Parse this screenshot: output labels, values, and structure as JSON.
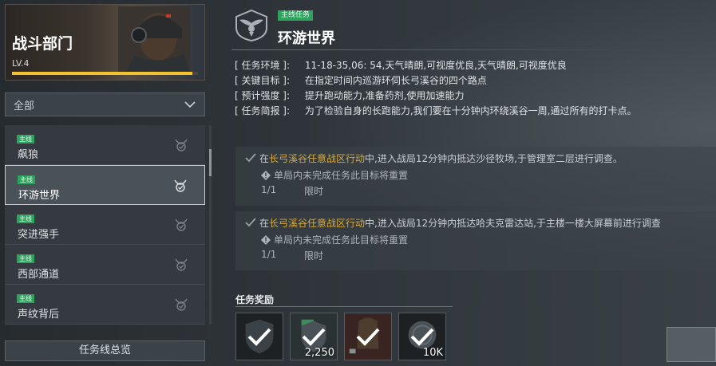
{
  "department": {
    "title": "战斗部门",
    "level": "LV.4",
    "progress": 0.97
  },
  "filter": {
    "selected": "全部",
    "icon": "chevron-down-icon"
  },
  "missions": [
    {
      "tag": "主线",
      "name": "飙狼",
      "state": "done"
    },
    {
      "tag": "主线",
      "name": "环游世界",
      "state": "done",
      "active": true
    },
    {
      "tag": "主线",
      "name": "突进强手",
      "state": "done"
    },
    {
      "tag": "主线",
      "name": "西部通道",
      "state": "done"
    },
    {
      "tag": "主线",
      "name": "声纹背后",
      "state": "done"
    }
  ],
  "overview_button": "任务线总览",
  "detail": {
    "tag": "主线任务",
    "title": "环游世界",
    "info": [
      {
        "label": "[ 任务环境 ]:",
        "value": "11-18-35,06: 54,天气晴朗,可视度优良,天气晴朗,可视度优良"
      },
      {
        "label": "[ 关键目标 ]:",
        "value": "在指定时间内巡游环伺长弓溪谷的四个路点"
      },
      {
        "label": "[ 预计强度 ]:",
        "value": "提升跑动能力,准备药剂,使用加速能力"
      },
      {
        "label": "[ 任务简报 ]:",
        "value": "为了检验自身的长跑能力,我们要在十分钟内环绕溪谷一周,通过所有的打卡点。"
      }
    ],
    "objectives": [
      {
        "prefix": "在",
        "highlight": "长弓溪谷任意战区行动",
        "suffix": "中,进入战局12分钟内抵达沙径牧场,于管理室二层进行调查。",
        "warning": "单局内未完成任务此目标将重置",
        "progress": "1/1",
        "limit": "限时"
      },
      {
        "prefix": "在",
        "highlight": "长弓溪谷任意战区行动",
        "suffix": "中,进入战局12分钟内抵达哈夫克雷达站,于主楼一楼大屏幕前进行调查",
        "warning": "单局内未完成任务此目标将重置",
        "progress": "1/1",
        "limit": "限时"
      }
    ],
    "rewards_label": "任务奖励",
    "rewards": [
      {
        "icon": "shield-reward-icon",
        "qty": ""
      },
      {
        "icon": "item-reward-icon",
        "qty": "2,250"
      },
      {
        "icon": "armor-reward-icon",
        "qty": ""
      },
      {
        "icon": "coin-reward-icon",
        "qty": "10K"
      }
    ]
  },
  "colors": {
    "accent_yellow": "#f2c230",
    "tag_green": "#2ea35d",
    "highlight_gold": "#d6a940"
  }
}
